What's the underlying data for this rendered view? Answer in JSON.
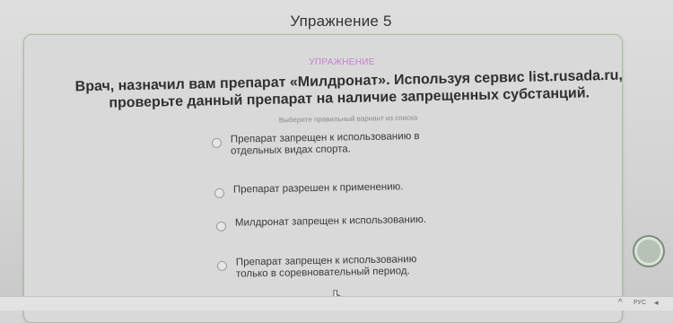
{
  "page": {
    "title": "Упражнение 5"
  },
  "card": {
    "badge": "УПРАЖНЕНИЕ",
    "question_line1": "Врач, назначил вам препарат «Милдронат». Используя сервис list.rusada.ru,",
    "question_line2": "проверьте данный препарат на наличие запрещенных субстанций.",
    "hint": "Выберите правильный вариант из списка",
    "options": [
      {
        "line1": "Препарат запрещен к использованию в",
        "line2": "отдельных видах спорта."
      },
      {
        "line1": "Препарат разрешен к применению.",
        "line2": ""
      },
      {
        "line1": "Милдронат запрещен к использованию.",
        "line2": ""
      },
      {
        "line1": "Препарат запрещен к использованию",
        "line2": "только в соревновательный период."
      }
    ]
  },
  "taskbar": {
    "chevron": "^",
    "language": "РУС",
    "arrow": "◂"
  },
  "colors": {
    "badge": "#c67ed0",
    "card_border": "#a8bca4",
    "background": "#d6d6d6"
  },
  "icons": {
    "side_button": "circle-button-icon",
    "cursor": "hand-pointer-icon"
  }
}
